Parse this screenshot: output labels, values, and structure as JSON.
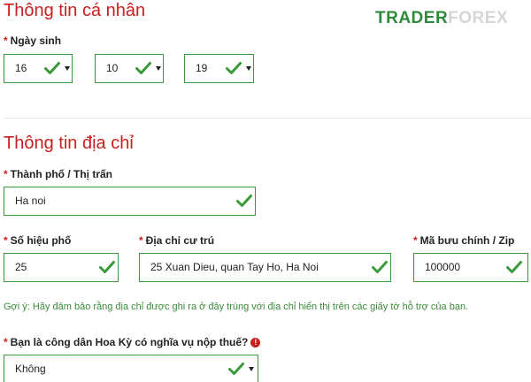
{
  "brand": {
    "logo_main": "TRADER",
    "logo_sub": "FOREX",
    "accent": "#2e8a3a"
  },
  "personal": {
    "title": "Thông tin cá nhân",
    "birth_label": "Ngày sinh",
    "day": "16",
    "month": "10",
    "year": "19"
  },
  "address": {
    "title": "Thông tin địa chỉ",
    "city_label": "Thành phố / Thị trấn",
    "city_value": "Ha noi",
    "street_no_label": "Số hiệu phố",
    "street_no_value": "25",
    "residence_label": "Địa chỉ cư trú",
    "residence_value": "25 Xuan Dieu, quan Tay Ho, Ha Noi",
    "zip_label": "Mã bưu chính / Zip",
    "zip_value": "100000",
    "hint": "Gợi ý: Hãy đảm bảo rằng địa chỉ được ghi ra ở đây trùng với địa chỉ hiển thị trên các giấy tờ hỗ trợ của bạn."
  },
  "tax": {
    "question": "Bạn là công dân Hoa Kỳ có nghĩa vụ nộp thuế?",
    "info_glyph": "!",
    "value": "Không"
  },
  "required_mark": "*",
  "colors": {
    "title_red": "#c8201e",
    "valid_green": "#3a9a3a",
    "hint_green": "#3a8a3a"
  }
}
